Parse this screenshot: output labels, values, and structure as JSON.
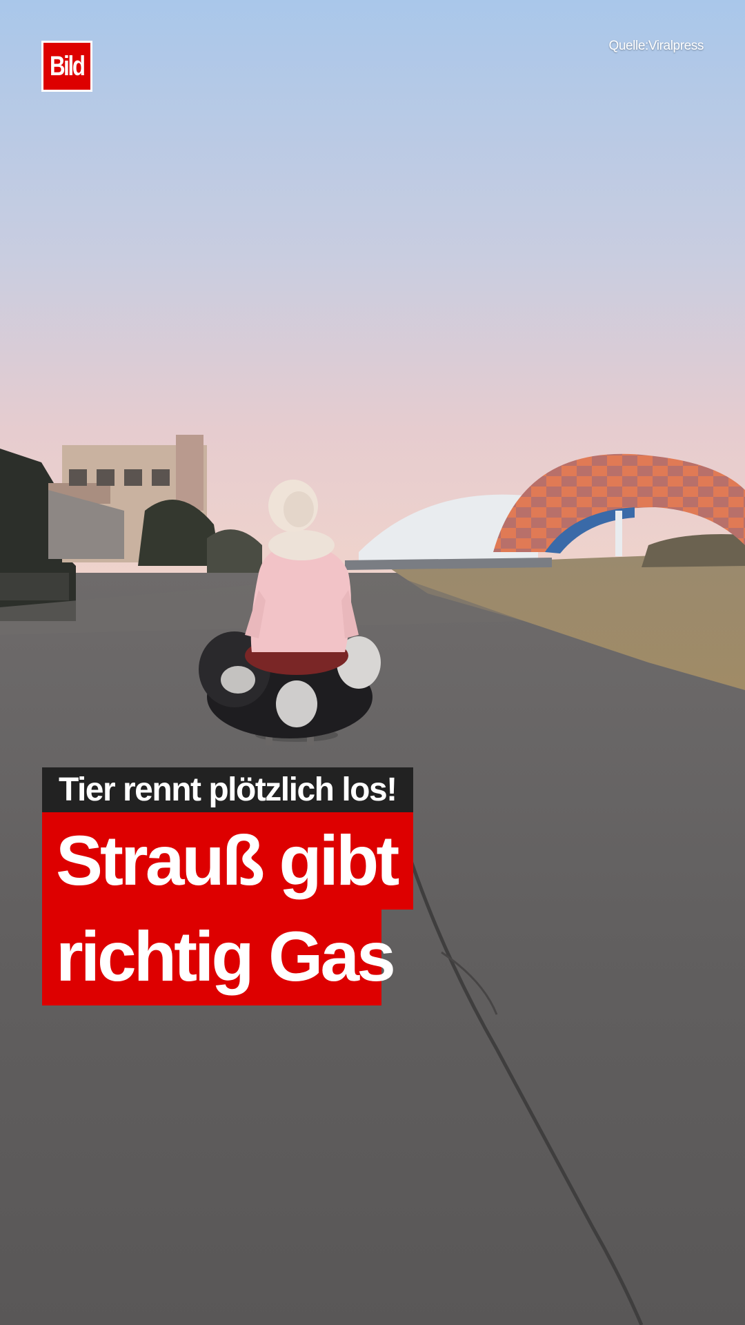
{
  "brand": {
    "logo_text": "Bild",
    "color": "#dd0000"
  },
  "source_credit": "Quelle:Viralpress",
  "kicker": "Tier rennt plötzlich los!",
  "headline": {
    "line1": "Strauß gibt",
    "line2": "richtig Gas"
  },
  "colors": {
    "kicker_bg": "#222222",
    "headline_bg": "#dd0000",
    "text": "#ffffff"
  }
}
